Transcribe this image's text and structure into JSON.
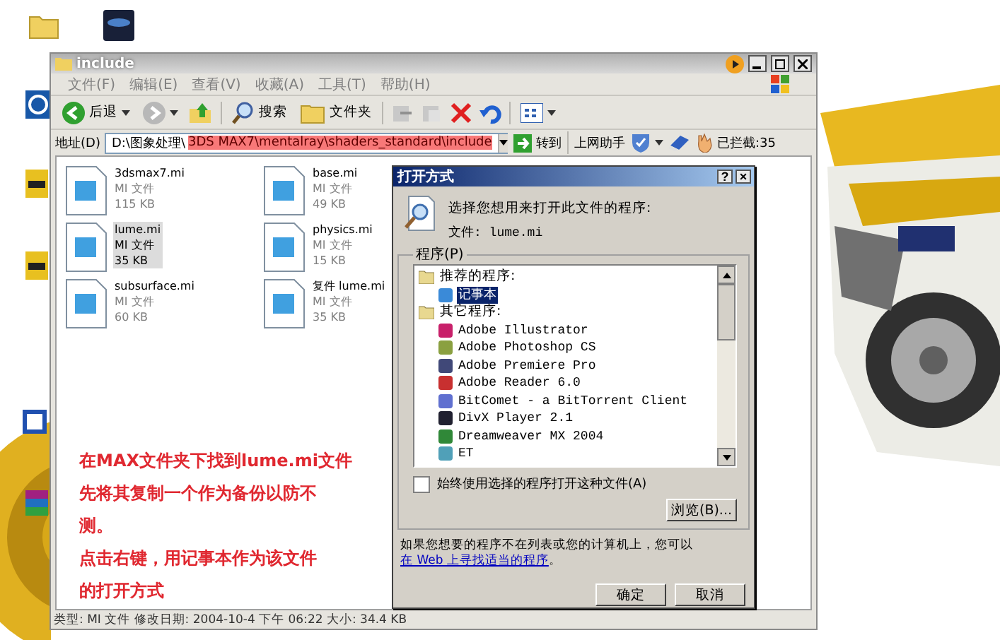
{
  "explorer": {
    "title": "include",
    "menu": [
      "文件(F)",
      "编辑(E)",
      "查看(V)",
      "收藏(A)",
      "工具(T)",
      "帮助(H)"
    ],
    "toolbar": {
      "back": "后退",
      "search": "搜索",
      "folders": "文件夹"
    },
    "address": {
      "label": "地址(D)",
      "parts": [
        {
          "text": "D:\\图象处理\\",
          "highlighted": false
        },
        {
          "text": "3DS MAX7\\mentalray\\shaders_standard\\include",
          "highlighted": true
        }
      ],
      "go": "转到",
      "assistant": "上网助手",
      "blocked": "已拦截:35"
    },
    "files": [
      {
        "name": "3dsmax7.mi",
        "type": "MI 文件",
        "size": "115 KB",
        "selected": false
      },
      {
        "name": "base.mi",
        "type": "MI 文件",
        "size": "49 KB",
        "selected": false
      },
      {
        "name": "lume.mi",
        "type": "MI 文件",
        "size": "35 KB",
        "selected": true
      },
      {
        "name": "physics.mi",
        "type": "MI 文件",
        "size": "15 KB",
        "selected": false
      },
      {
        "name": "subsurface.mi",
        "type": "MI 文件",
        "size": "60 KB",
        "selected": false
      },
      {
        "name": "复件 lume.mi",
        "type": "MI 文件",
        "size": "35 KB",
        "selected": false
      }
    ],
    "notes": [
      {
        "lines": [
          "在MAX文件夹下找到lume.mi文件",
          "先将其复制一个作为备份以防不",
          "测。"
        ]
      },
      {
        "lines": [
          "点击右键，用记事本作为该文件",
          "的打开方式"
        ]
      }
    ],
    "status_bar": "类型: MI 文件 修改日期: 2004-10-4 下午 06:22 大小: 34.4 KB"
  },
  "dialog": {
    "title": "打开方式",
    "help": "?",
    "close": "×",
    "prompt": "选择您想用来打开此文件的程序:",
    "file_label": "文件: lume.mi",
    "group": "程序(P)",
    "programs": [
      {
        "label": "推荐的程序:",
        "selected": false,
        "children": [
          {
            "label": "记事本",
            "selected": true,
            "color": "#3a8ad8"
          }
        ]
      },
      {
        "label": "其它程序:",
        "selected": false,
        "children": [
          {
            "label": "Adobe Illustrator",
            "selected": false,
            "color": "#c8206a"
          },
          {
            "label": "Adobe Photoshop CS",
            "selected": false,
            "color": "#8aa040"
          },
          {
            "label": "Adobe Premiere Pro",
            "selected": false,
            "color": "#404878"
          },
          {
            "label": "Adobe Reader 6.0",
            "selected": false,
            "color": "#c83030"
          },
          {
            "label": "BitComet - a BitTorrent Client",
            "selected": false,
            "color": "#6070d0"
          },
          {
            "label": "DivX Player 2.1",
            "selected": false,
            "color": "#202030"
          },
          {
            "label": "Dreamweaver MX 2004",
            "selected": false,
            "color": "#308838"
          },
          {
            "label": "ET",
            "selected": false,
            "color": "#50a0b8"
          }
        ]
      }
    ],
    "always": {
      "label": "始终使用选择的程序打开这种文件(A)",
      "checked": false
    },
    "browse": "浏览(B)...",
    "hint": "如果您想要的程序不在列表或您的计算机上，您可以",
    "link": "在 Web 上寻找适当的程序",
    "link_end": "。",
    "ok": "确定",
    "cancel": "取消"
  }
}
